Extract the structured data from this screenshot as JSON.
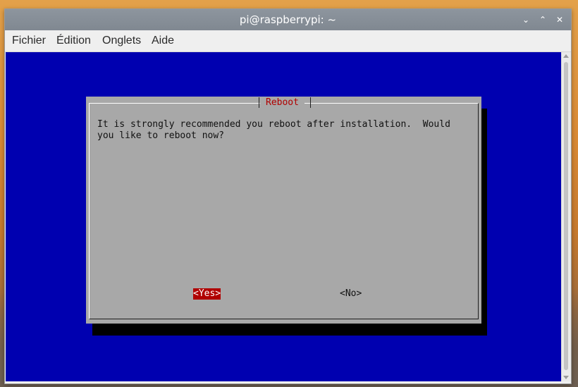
{
  "window": {
    "title": "pi@raspberrypi: ~",
    "minimize_label": "⌄",
    "maximize_label": "⌃",
    "close_label": "✕"
  },
  "menubar": {
    "items": [
      "Fichier",
      "Édition",
      "Onglets",
      "Aide"
    ]
  },
  "dialog": {
    "title": "Reboot",
    "message": "It is strongly recommended you reboot after installation.  Would\nyou like to reboot now?",
    "buttons": {
      "yes": "<Yes>",
      "no": "<No>"
    },
    "selected_button": "yes"
  },
  "colors": {
    "terminal_background": "#0000b0",
    "dialog_background": "#a8a8a8",
    "dialog_title": "#b00000",
    "selected_button_background": "#b00000",
    "titlebar": "#858d96"
  },
  "icons": [
    "minimize-icon",
    "maximize-icon",
    "close-icon"
  ]
}
